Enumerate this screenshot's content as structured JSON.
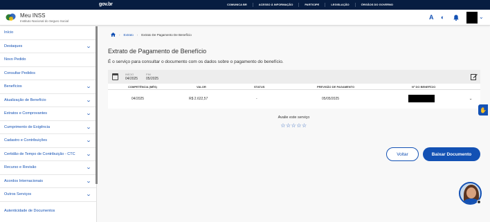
{
  "topbar": {
    "brand": "gov.br",
    "links": [
      "COMUNICA BR",
      "ACESSO À INFORMAÇÃO",
      "PARTICIPE",
      "LEGISLAÇÃO",
      "ÓRGÃOS DO GOVERNO"
    ]
  },
  "header": {
    "title": "Meu INSS",
    "subtitle": "Instituto Nacional do Seguro Social",
    "contrast_icon": "A"
  },
  "sidebar": {
    "items": [
      {
        "label": "Início",
        "chevron": false
      },
      {
        "label": "Destaques",
        "chevron": true
      },
      {
        "label": "Novo Pedido",
        "chevron": false
      },
      {
        "label": "Consultar Pedidos",
        "chevron": false
      },
      {
        "label": "Benefícios",
        "chevron": true
      },
      {
        "label": "Atualização de Benefício",
        "chevron": true
      },
      {
        "label": "Extratos e Comprovantes",
        "chevron": true
      },
      {
        "label": "Cumprimento de Exigência",
        "chevron": true
      },
      {
        "label": "Cadastro e Contribuições",
        "chevron": true
      },
      {
        "label": "Certidão de Tempo de Contribuição - CTC",
        "chevron": true
      },
      {
        "label": "Recurso e Revisão",
        "chevron": true
      },
      {
        "label": "Acordos Internacionais",
        "chevron": true
      },
      {
        "label": "Outros Serviços",
        "chevron": true
      },
      {
        "label": "Autenticidade de Documentos",
        "chevron": false
      }
    ]
  },
  "breadcrumb": {
    "item1": "Extrato",
    "item2": "Extrato De Pagamento De Benefício"
  },
  "main": {
    "title": "Extrato de Pagamento de Benefício",
    "description": "É o serviço para consultar o documento com os dados sobre o pagamento do benefício.",
    "period": {
      "start_label": "INÍCIO",
      "start_value": "04/2025",
      "end_label": "FIM",
      "end_value": "05/2025"
    },
    "columns": [
      "COMPETÊNCIA (MÊS)",
      "VALOR",
      "STATUS",
      "PREVISÃO DE PAGAMENTO",
      "Nº DO BENEFÍCIO"
    ],
    "row": {
      "competencia": "04/2025",
      "valor": "R$ 2.622,57",
      "status": "-",
      "previsao": "05/05/2025"
    },
    "rate_label": "Avalie este serviço",
    "stars": "☆☆☆☆☆",
    "btn_back": "Voltar",
    "btn_download": "Baixar Documento"
  }
}
